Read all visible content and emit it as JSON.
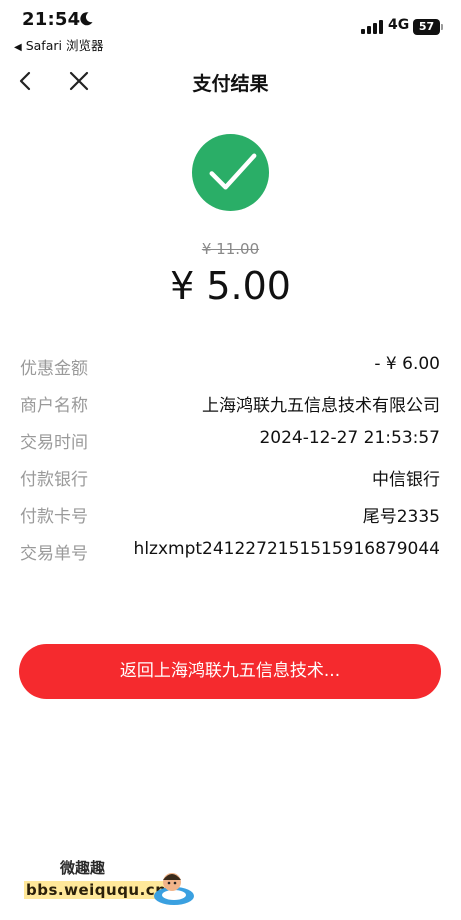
{
  "status_bar": {
    "time": "21:54",
    "back_app": "Safari 浏览器",
    "network": "4G",
    "battery": "57"
  },
  "nav": {
    "title": "支付结果"
  },
  "payment": {
    "original_amount": "¥ 11.00",
    "paid_amount": "¥ 5.00"
  },
  "details": [
    {
      "label": "优惠金额",
      "value": "- ¥ 6.00"
    },
    {
      "label": "商户名称",
      "value": "上海鸿联九五信息技术有限公司"
    },
    {
      "label": "交易时间",
      "value": "2024-12-27 21:53:57"
    },
    {
      "label": "付款银行",
      "value": "中信银行"
    },
    {
      "label": "付款卡号",
      "value": "尾号2335"
    },
    {
      "label": "交易单号",
      "value": "hlzxmpt2412272151515916879044"
    }
  ],
  "button": {
    "label": "返回上海鸿联九五信息技术..."
  },
  "watermark": {
    "title": "微趣趣",
    "url": "bbs.weiququ.cn"
  },
  "colors": {
    "success_green": "#2aae67",
    "button_red": "#f52a2e",
    "label_gray": "#9a9a9a"
  }
}
